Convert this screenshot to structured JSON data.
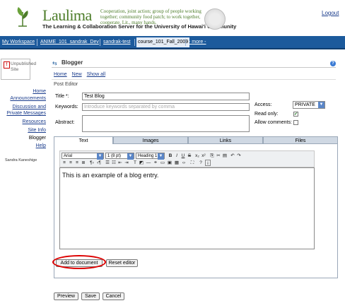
{
  "header": {
    "brand": "Laulima",
    "tagline": "Cooperation, joint action; group of people working together; community food patch; to work together, cooperate. Lit., many hands.",
    "subtitle": "The Learning & Collaboration Server for the University of Hawai'i Community",
    "logout": "Logout"
  },
  "site_tabs": [
    "My Workspace",
    "ANIME_101_sandrak_Dev",
    "sandrak-test",
    "course_101_Fall_2009",
    "- more -"
  ],
  "sidebar": {
    "unpublished": "Unpublished Site",
    "items": [
      "Home",
      "Announcements",
      "Discussion and Private Messages",
      "Resources",
      "Site Info",
      "Blogger",
      "Help"
    ],
    "user": "Sandra Kaneshige"
  },
  "tool": {
    "title": "Blogger",
    "nav": [
      "Home",
      "New",
      "Show all"
    ],
    "section": "Post Editor"
  },
  "form": {
    "title_label": "Title *:",
    "title_value": "Test Blog",
    "keywords_label": "Keywords:",
    "keywords_placeholder": "Introduce keywords separated by comma",
    "abstract_label": "Abstract:",
    "abstract_value": "",
    "access_label": "Access:",
    "access_value": "PRIVATE",
    "readonly_label": "Read only:",
    "readonly_checked": true,
    "comments_label": "Allow comments:",
    "comments_checked": false
  },
  "editor": {
    "tabs": [
      "Text",
      "Images",
      "Links",
      "Files"
    ],
    "active_tab": "Text",
    "font": "Arial",
    "size": "1 (8 pt)",
    "heading": "Heading 1",
    "content": "This is an example of a blog entry.",
    "add_button": "Add to document",
    "reset_button": "Reset editor"
  },
  "actions": {
    "preview": "Preview",
    "save": "Save",
    "cancel": "Cancel"
  },
  "colors": {
    "brand_green": "#4d7d2a",
    "site_bar": "#1c5a9c",
    "highlight": "#dd0000"
  }
}
